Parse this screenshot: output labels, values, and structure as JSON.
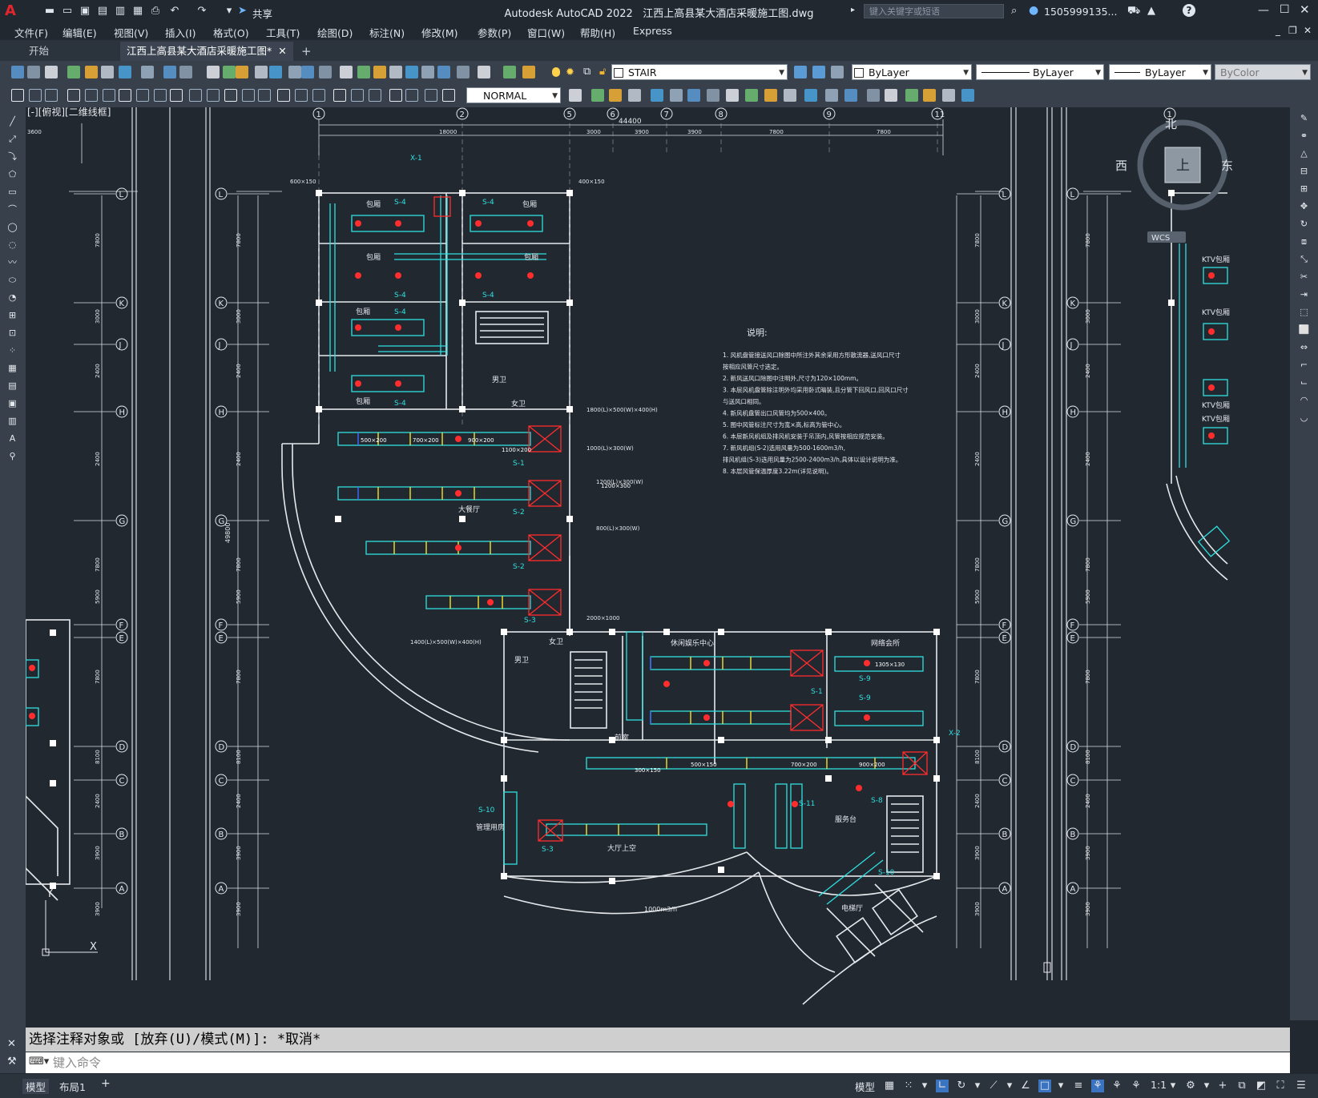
{
  "app": {
    "title": "Autodesk AutoCAD 2022",
    "document": "江西上高县某大酒店采暖施工图.dwg",
    "logo": "A",
    "share_label": "共享",
    "search_placeholder": "键入关键字或短语",
    "user": "1505999135...",
    "help_icon": "help-icon"
  },
  "menu": [
    "文件(F)",
    "编辑(E)",
    "视图(V)",
    "插入(I)",
    "格式(O)",
    "工具(T)",
    "绘图(D)",
    "标注(N)",
    "修改(M)",
    "参数(P)",
    "窗口(W)",
    "帮助(H)",
    "Express"
  ],
  "tabs": {
    "start": "开始",
    "drawing": "江西上高县某大酒店采暖施工图*",
    "add": "+"
  },
  "toolbar": {
    "layer": "STAIR",
    "color": "ByLayer",
    "linetype": "ByLayer",
    "lineweight": "ByLayer",
    "plotstyle": "ByColor",
    "dimstyle": "NORMAL"
  },
  "viewport": {
    "label": "[-][俯视][二维线框]",
    "viewcube": {
      "north": "北",
      "west": "西",
      "east": "东",
      "top": "上",
      "wcs": "WCS"
    }
  },
  "drawing": {
    "axes_top": [
      "1",
      "2",
      "5",
      "6",
      "7",
      "8",
      "9",
      "11",
      "1"
    ],
    "axes_left": [
      "L",
      "K",
      "J",
      "H",
      "G",
      "F",
      "E",
      "D",
      "C",
      "B",
      "A"
    ],
    "overall_dim": "44400",
    "top_dims": [
      "3600",
      "18000",
      "3000",
      "3900",
      "3900",
      "7800",
      "7800"
    ],
    "left_dims": [
      "7800",
      "3000",
      "2400",
      "2400",
      "7800",
      "7800",
      "5900",
      "8100",
      "2400",
      "3900",
      "3900"
    ],
    "left_overall": "49800",
    "notes_title": "说明:",
    "notes": [
      "1. 风机盘管接送风口除图中所注外其余采用方形散流器,送风口尺寸",
      "按相应风管尺寸选定。",
      "2. 新风送风口除图中注明外,尺寸为120×100mm。",
      "3. 本层风机盘管除注明外均采用卧式暗装,且分管下回风口,回风口尺寸",
      "与送风口相同。",
      "4. 新风机盘管出口风管均为500×400。",
      "5. 图中风管标注尺寸为宽×高,标高为管中心。",
      "6. 本层新风机组及排风机安装于吊顶内,风管按相应规范安装。",
      "7. 新风机组(S-2)选用风量为500-1600m3/h,",
      "排风机组(S-3)选用风量为2500-2400m3/h,具体以设计说明为准。",
      "8. 本层风管保温厚度3.22m(详见说明)。"
    ],
    "rooms": [
      "包厢",
      "包厢",
      "包厢",
      "包厢",
      "包厢",
      "包厢",
      "大餐厅",
      "休闲娱乐中心",
      "网络会所",
      "男卫",
      "女卫",
      "女卫",
      "男卫",
      "前室",
      "管理用房",
      "大厅上空",
      "服务台",
      "电梯厅",
      "KTV包厢",
      "KTV包厢",
      "KTV包厢",
      "KTV包厢"
    ],
    "units": [
      "S-4",
      "S-4",
      "S-4",
      "S-4",
      "S-4",
      "S-4",
      "S-1",
      "S-2",
      "S-2",
      "S-3",
      "S-1",
      "S-9",
      "S-9",
      "S-10",
      "S-3",
      "S-8",
      "S-11",
      "S-10",
      "X-1",
      "X-2"
    ],
    "duct_sizes": [
      "500×200",
      "700×200",
      "900×200",
      "1100×200",
      "1305×130",
      "300×150",
      "500×150",
      "700×200",
      "900×200",
      "1200×300"
    ],
    "equip_labels": [
      "600×150",
      "400×150",
      "1800(L)×500(W)×400(H)",
      "1400(L)×500(W)×400(H)",
      "1000(L)×300(W)",
      "1200(L)×300(W)",
      "800(L)×300(W)",
      "2000×1000"
    ],
    "airflow": "1000m3/h"
  },
  "command": {
    "history": "选择注释对象或 [放弃(U)/模式(M)]: *取消*",
    "placeholder": "键入命令"
  },
  "status": {
    "tabs": [
      "模型",
      "布局1"
    ],
    "add": "+",
    "model_label": "模型",
    "scale": "1:1"
  }
}
